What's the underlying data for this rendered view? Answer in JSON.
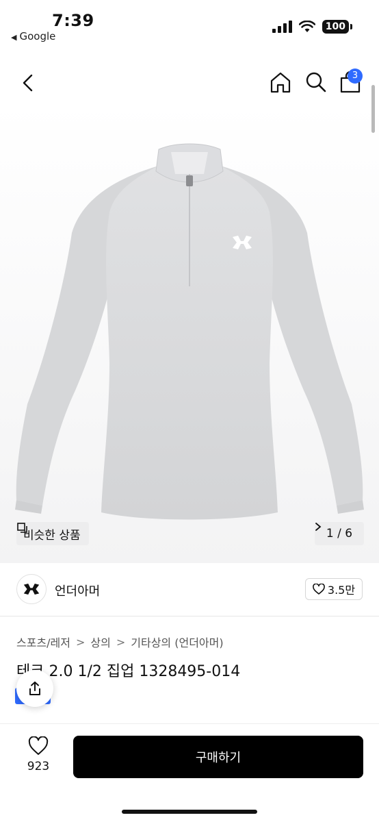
{
  "status_bar": {
    "time": "7:39",
    "back_app": "Google",
    "battery": "100"
  },
  "nav": {
    "cart_count": "3",
    "icons": [
      "chevron-left-icon",
      "home-icon",
      "search-icon",
      "shopping-bag-icon"
    ]
  },
  "gallery": {
    "similar_label": "비슷한 상품",
    "page_indicator": "1 / 6"
  },
  "brand": {
    "name": "언더아머",
    "likes": "3.5만"
  },
  "breadcrumb": {
    "items": [
      "스포츠/레저",
      "상의",
      "기타상의 (언더아머)"
    ]
  },
  "product": {
    "title": "테크 2.0 1/2 집업 1328495-014"
  },
  "bottom_bar": {
    "wish_count": "923",
    "buy_label": "구매하기"
  },
  "colors": {
    "accent_blue": "#2f6bff",
    "buy_button": "#000000",
    "shirt": "#d9dadc"
  }
}
